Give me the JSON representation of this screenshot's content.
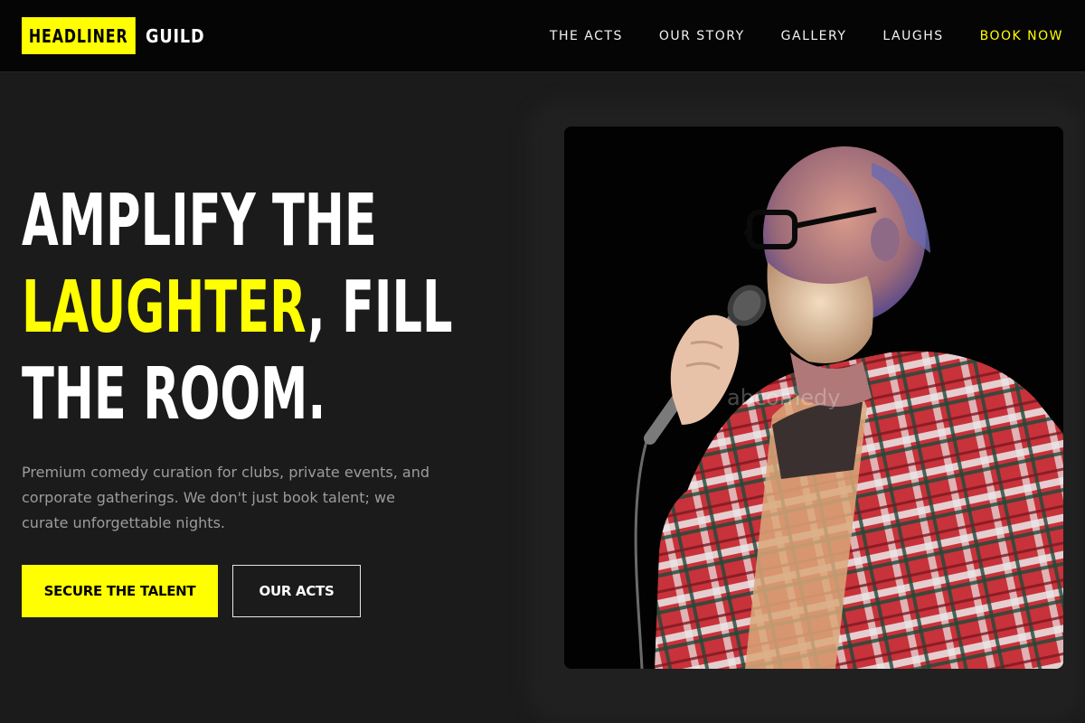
{
  "brand": {
    "name_primary": "HEADLINER",
    "name_secondary": "GUILD",
    "accent_color": "#ffff00"
  },
  "nav": {
    "items": [
      {
        "label": "THE ACTS"
      },
      {
        "label": "OUR STORY"
      },
      {
        "label": "GALLERY"
      },
      {
        "label": "LAUGHS"
      },
      {
        "label": "BOOK NOW"
      }
    ]
  },
  "hero": {
    "title_line1": "AMPLIFY THE",
    "title_accent": "LAUGHTER",
    "title_line2_rest": ", FILL",
    "title_line3": "THE ROOM.",
    "subtitle": "Premium comedy curation for clubs, private events, and corporate gatherings. We don't just book talent; we curate unforgettable nights.",
    "primary_button": "SECURE THE TALENT",
    "secondary_button": "OUR ACTS"
  },
  "image": {
    "subject": "comedian-with-microphone",
    "watermark": "abcomedy"
  }
}
